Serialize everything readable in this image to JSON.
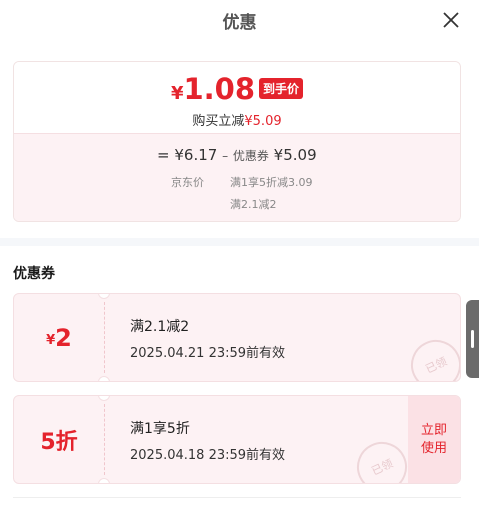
{
  "header": {
    "title": "优惠",
    "close_icon": "close-icon"
  },
  "summary": {
    "currency": "¥",
    "final_price": "1.08",
    "final_tag": "到手价",
    "instant_label": "购买立减",
    "instant_amount": "¥5.09",
    "calc_equals": "=",
    "calc_base": "¥6.17",
    "calc_minus": "–",
    "calc_coupon_label": "优惠券",
    "calc_coupon_amount": "¥5.09",
    "base_label": "京东价",
    "rule_1": "满1享5折减3.09",
    "rule_2": "满2.1减2"
  },
  "coupons_section": {
    "title": "优惠券",
    "items": [
      {
        "value_currency": "¥",
        "value": "2",
        "condition": "满2.1减2",
        "expiry": "2025.04.21 23:59前有效",
        "stamp": "已领"
      },
      {
        "value": "5折",
        "condition": "满1享5折",
        "expiry": "2025.04.18 23:59前有效",
        "action": "立即使用",
        "stamp": "已领"
      }
    ]
  },
  "colors": {
    "accent": "#e4232c",
    "card_bg": "#fdf2f4",
    "button_bg": "#fbe1e5"
  }
}
